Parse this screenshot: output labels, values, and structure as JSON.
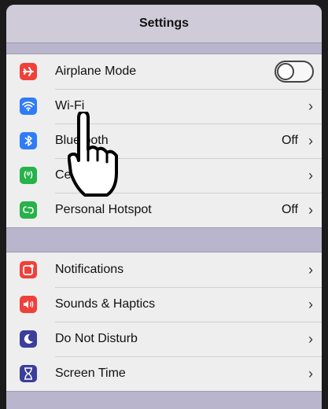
{
  "nav": {
    "title": "Settings"
  },
  "group1": [
    {
      "name": "airplane-mode",
      "label": "Airplane Mode",
      "icon": "airplane-icon",
      "color": "#f0403a",
      "control": "toggle",
      "value": "",
      "toggle_state": "off"
    },
    {
      "name": "wifi",
      "label": "Wi-Fi",
      "icon": "wifi-icon",
      "color": "#2f7cf6",
      "control": "chevron",
      "value": ""
    },
    {
      "name": "bluetooth",
      "label": "Bluetooth",
      "icon": "bluetooth-icon",
      "color": "#2f7cf6",
      "control": "chevron",
      "value": "Off"
    },
    {
      "name": "cellular",
      "label": "Cellular",
      "icon": "cellular-icon",
      "color": "#27b24a",
      "control": "chevron",
      "value": ""
    },
    {
      "name": "personal-hotspot",
      "label": "Personal Hotspot",
      "icon": "hotspot-icon",
      "color": "#27b24a",
      "control": "chevron",
      "value": "Off"
    }
  ],
  "group2": [
    {
      "name": "notifications",
      "label": "Notifications",
      "icon": "notifications-icon",
      "color": "#f0403a",
      "control": "chevron",
      "value": ""
    },
    {
      "name": "sounds-haptics",
      "label": "Sounds & Haptics",
      "icon": "speaker-icon",
      "color": "#f0403a",
      "control": "chevron",
      "value": ""
    },
    {
      "name": "do-not-disturb",
      "label": "Do Not Disturb",
      "icon": "moon-icon",
      "color": "#3b3f99",
      "control": "chevron",
      "value": ""
    },
    {
      "name": "screen-time",
      "label": "Screen Time",
      "icon": "hourglass-icon",
      "color": "#3b3f99",
      "control": "chevron",
      "value": ""
    }
  ],
  "chevron_glyph": "›",
  "overlay": {
    "icon": "pointing-hand-icon"
  }
}
